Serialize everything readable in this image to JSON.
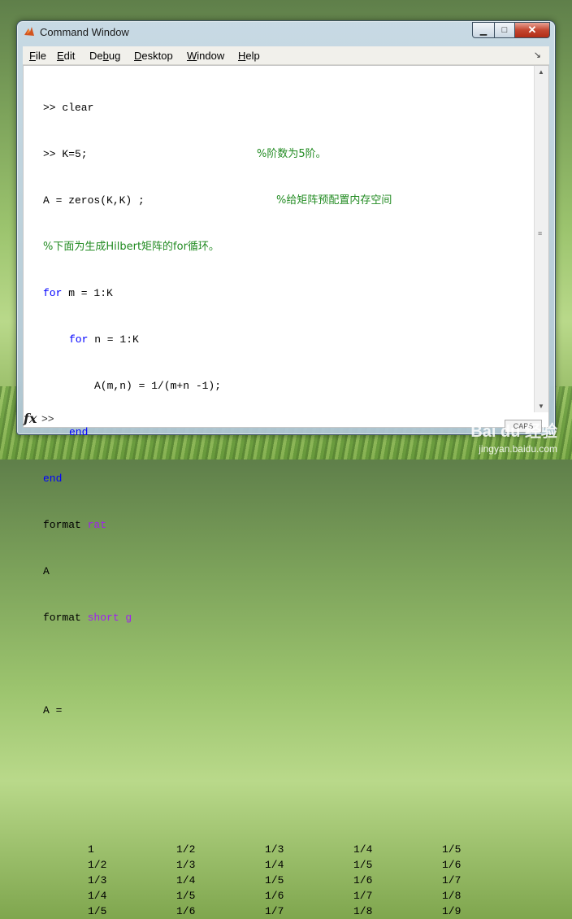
{
  "window": {
    "title": "Command Window"
  },
  "window_buttons": {
    "minimize": "▁",
    "maximize": "□",
    "close": "✕"
  },
  "menu": [
    "File",
    "Edit",
    "Debug",
    "Desktop",
    "Window",
    "Help"
  ],
  "menu_underline": [
    "F",
    "E",
    "b",
    "D",
    "W",
    "H"
  ],
  "code": {
    "l1": ">> clear",
    "l2_a": ">> K=5;",
    "l2_c": "%阶数为5阶。",
    "l3_a": "A = zeros(K,K) ;",
    "l3_c": "%给矩阵预配置内存空间",
    "l4_c": "%下面为生成Hilbert矩阵的for循环。",
    "l5_kw": "for",
    "l5_rest": " m = 1:K",
    "l6_kw": "for",
    "l6_rest": " n = 1:K",
    "l7": "A(m,n) = 1/(m+n -1);",
    "l8_kw": "end",
    "l9_kw": "end",
    "l10_a": "format ",
    "l10_s": "rat",
    "l11": "A",
    "l12_a": "format ",
    "l12_s": "short g",
    "l13": "A ="
  },
  "matrix": [
    [
      "1",
      "1/2",
      "1/3",
      "1/4",
      "1/5"
    ],
    [
      "1/2",
      "1/3",
      "1/4",
      "1/5",
      "1/6"
    ],
    [
      "1/3",
      "1/4",
      "1/5",
      "1/6",
      "1/7"
    ],
    [
      "1/4",
      "1/5",
      "1/6",
      "1/7",
      "1/8"
    ],
    [
      "1/5",
      "1/6",
      "1/7",
      "1/8",
      "1/9"
    ]
  ],
  "prompt": ">>",
  "fx_label": "fx",
  "status": {
    "caps": "CAPS"
  },
  "watermark": {
    "brand": "Bai du 经验",
    "url": "jingyan.baidu.com"
  },
  "colors": {
    "keyword": "#0000ff",
    "string": "#a020f0",
    "comment": "#228b22"
  }
}
